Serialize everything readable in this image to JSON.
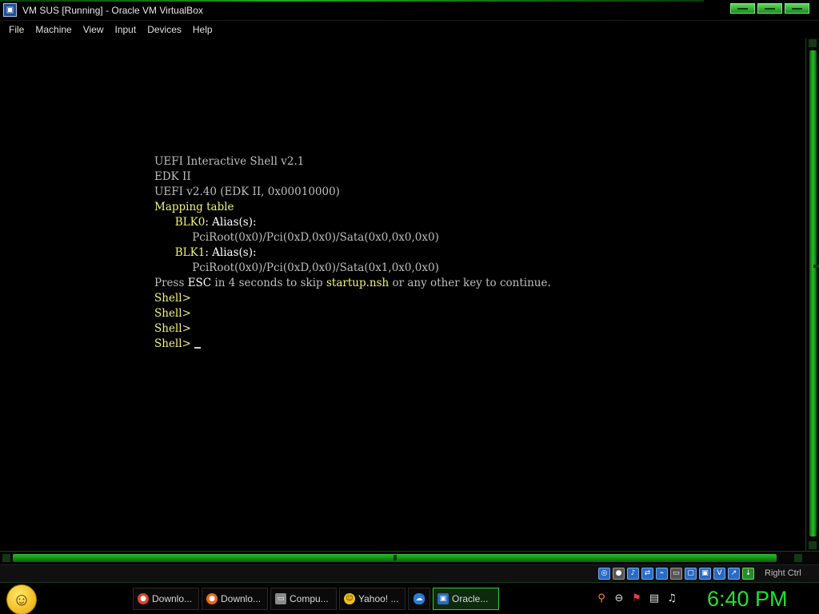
{
  "window": {
    "title": "VM SUS [Running] - Oracle VM VirtualBox",
    "app_icon": "virtualbox-icon"
  },
  "menu": [
    "File",
    "Machine",
    "View",
    "Input",
    "Devices",
    "Help"
  ],
  "console": {
    "line1": "UEFI Interactive Shell v2.1",
    "line2": "EDK II",
    "line3": "UEFI v2.40 (EDK II, 0x00010000)",
    "line4": "Mapping table",
    "blk0_name": "BLK0",
    "blk0_alias": ": Alias(s):",
    "blk0_path": "PciRoot(0x0)/Pci(0xD,0x0)/Sata(0x0,0x0,0x0)",
    "blk1_name": "BLK1",
    "blk1_alias": ": Alias(s):",
    "blk1_path": "PciRoot(0x0)/Pci(0xD,0x0)/Sata(0x1,0x0,0x0)",
    "press_pre": "Press ",
    "press_esc": "ESC",
    "press_mid": " in 4 seconds to skip ",
    "press_file": "startup.nsh",
    "press_post": " or any other key to continue.",
    "prompt": "Shell>"
  },
  "statusbar": {
    "host_key": "Right Ctrl"
  },
  "taskbar": {
    "tasks": [
      {
        "label": "Downlo...",
        "icon": "chrome-icon",
        "color": "#d9442f"
      },
      {
        "label": "Downlo...",
        "icon": "firefox-icon",
        "color": "#e86a1c"
      },
      {
        "label": "Compu...",
        "icon": "computer-icon",
        "color": "#8a8a8a"
      },
      {
        "label": "Yahoo! ...",
        "icon": "yahoo-smiley-icon",
        "color": "#f0c020"
      },
      {
        "label": "",
        "icon": "onedrive-icon",
        "color": "#2a7ad8"
      },
      {
        "label": "Oracle...",
        "icon": "virtualbox-icon",
        "color": "#2a6bc4"
      }
    ],
    "clock": "6:40 PM"
  }
}
